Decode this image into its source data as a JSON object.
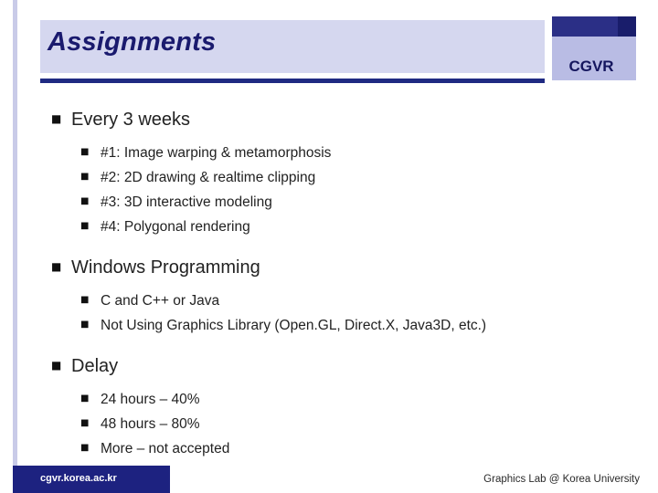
{
  "slide": {
    "title": "Assignments",
    "logo": {
      "text": "CGVR"
    },
    "bullets": [
      {
        "level": 1,
        "marker": "■",
        "text": "Every 3 weeks"
      },
      {
        "level": 2,
        "marker": "■",
        "text": "#1: Image warping & metamorphosis"
      },
      {
        "level": 2,
        "marker": "■",
        "text": "#2: 2D drawing & realtime clipping"
      },
      {
        "level": 2,
        "marker": "■",
        "text": "#3: 3D interactive modeling"
      },
      {
        "level": 2,
        "marker": "■",
        "text": "#4: Polygonal rendering"
      },
      {
        "level": 1,
        "marker": "■",
        "text": "Windows Programming"
      },
      {
        "level": 2,
        "marker": "■",
        "text": "C and C++ or Java"
      },
      {
        "level": 2,
        "marker": "■",
        "text": "Not Using Graphics Library (Open.GL, Direct.X, Java3D, etc.)"
      },
      {
        "level": 1,
        "marker": "■",
        "text": "Delay"
      },
      {
        "level": 2,
        "marker": "■",
        "text": "24 hours – 40%"
      },
      {
        "level": 2,
        "marker": "■",
        "text": "48 hours – 80%"
      },
      {
        "level": 2,
        "marker": "■",
        "text": "More – not accepted"
      }
    ],
    "footer": {
      "left": "cgvr.korea.ac.kr",
      "right": "Graphics Lab @ Korea University"
    },
    "colors": {
      "title_band": "#d5d7ef",
      "title_text": "#1a1a6e",
      "rule": "#1f2a82",
      "logo_dark": "#2b2f86",
      "logo_light": "#b9bce4",
      "footer_bar": "#1d2280",
      "left_band": "#c9cbe8"
    }
  }
}
